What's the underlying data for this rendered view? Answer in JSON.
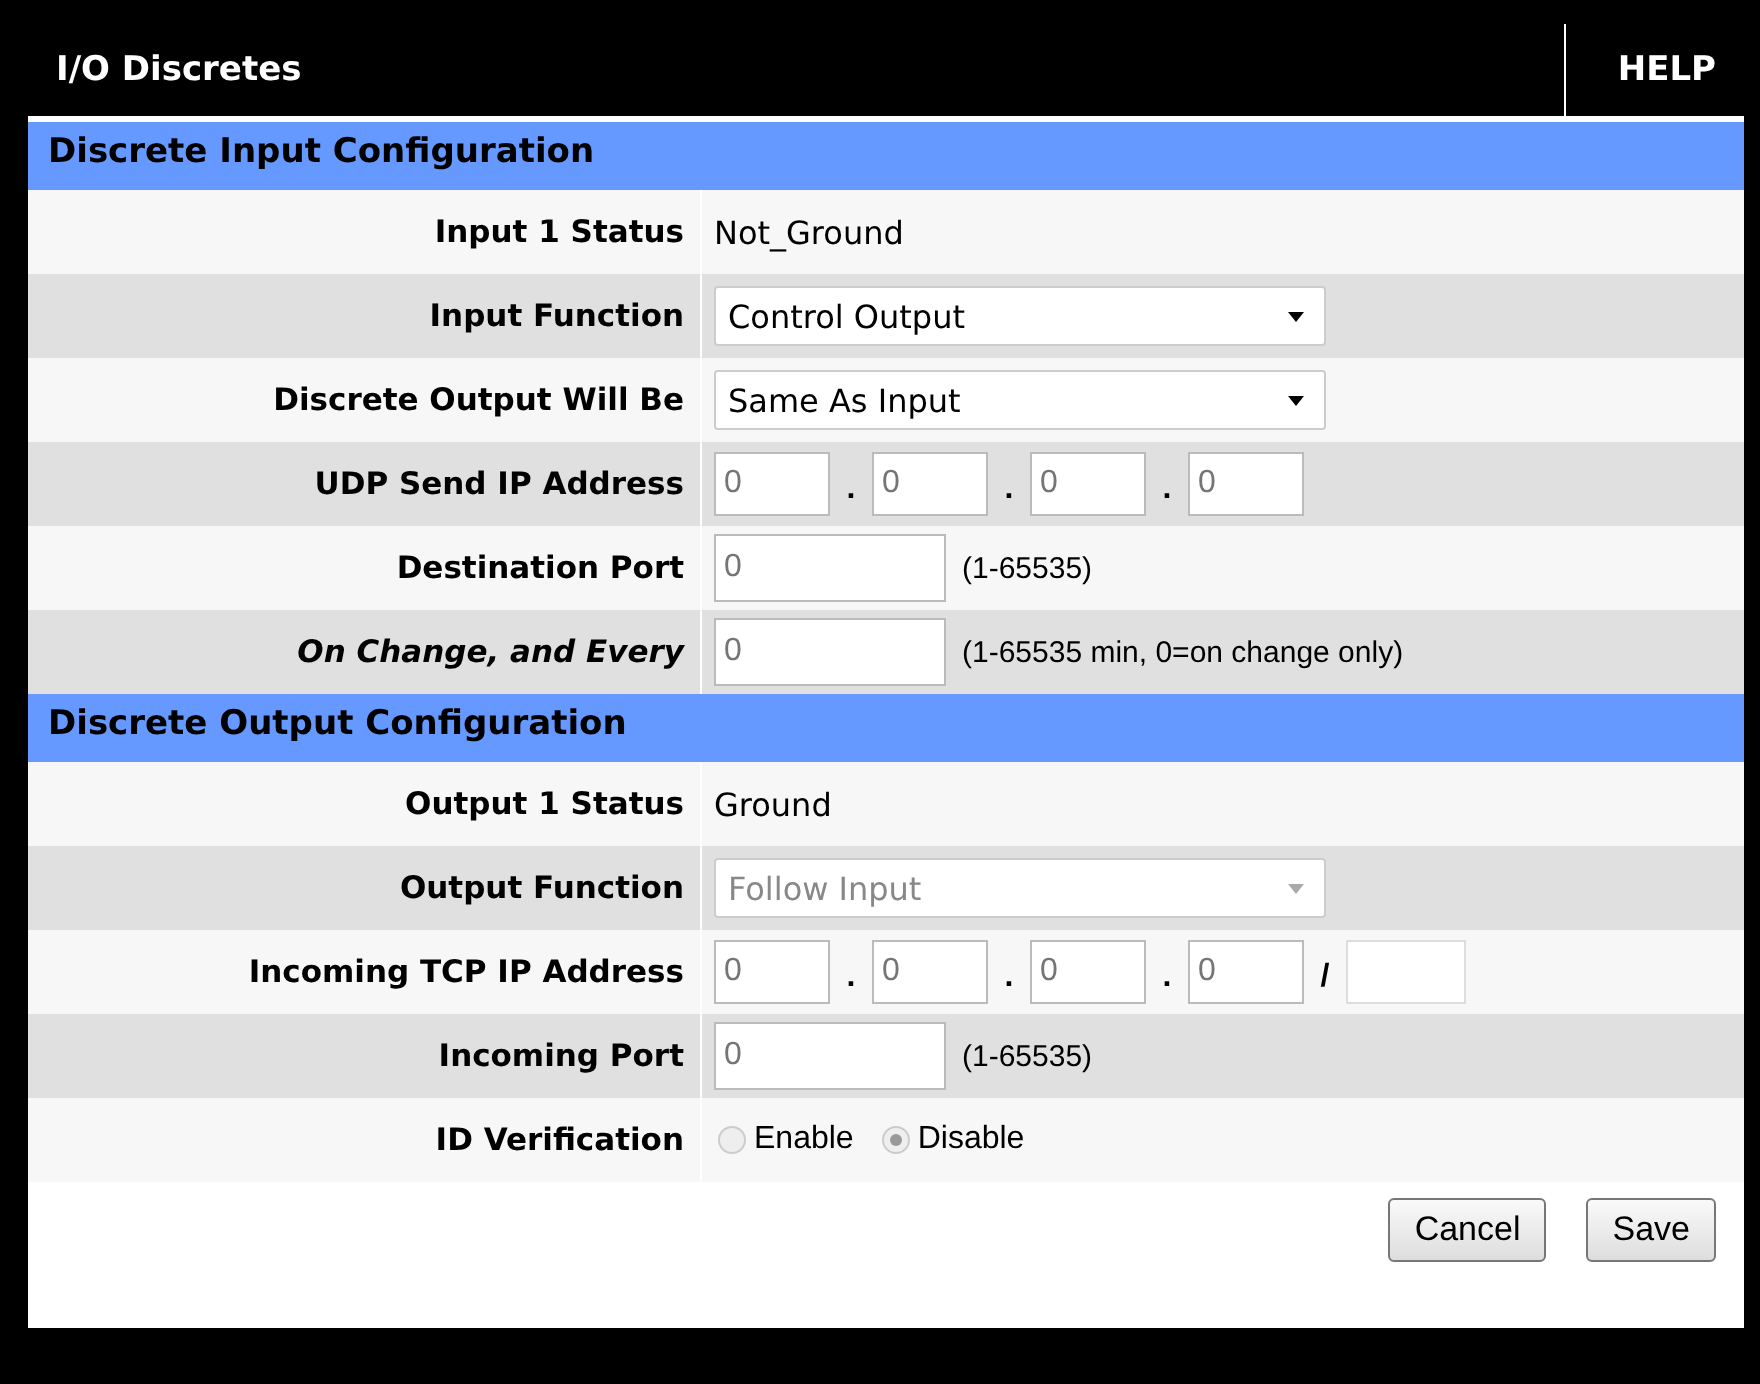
{
  "header": {
    "title": "I/O Discretes",
    "help": "HELP"
  },
  "sections": [
    {
      "title": "Discrete Input Configuration",
      "rows": [
        {
          "kind": "text",
          "label": "Input 1 Status",
          "italic": false,
          "value": "Not_Ground"
        },
        {
          "kind": "select",
          "label": "Input Function",
          "italic": false,
          "value": "Control Output",
          "disabled": false
        },
        {
          "kind": "select",
          "label": "Discrete Output Will Be",
          "italic": false,
          "value": "Same As Input",
          "disabled": false
        },
        {
          "kind": "ip",
          "label": "UDP Send IP Address",
          "italic": false,
          "placeholders": [
            "0",
            "0",
            "0",
            "0"
          ],
          "separators": [
            ".",
            ".",
            "."
          ]
        },
        {
          "kind": "input",
          "label": "Destination Port",
          "italic": false,
          "placeholder": "0",
          "hint": "(1-65535)"
        },
        {
          "kind": "input",
          "label": "On Change, and Every",
          "italic": true,
          "placeholder": "0",
          "hint": "(1-65535 min, 0=on change only)"
        }
      ]
    },
    {
      "title": "Discrete Output Configuration",
      "rows": [
        {
          "kind": "text",
          "label": "Output 1 Status",
          "italic": false,
          "value": "Ground"
        },
        {
          "kind": "select",
          "label": "Output Function",
          "italic": false,
          "value": "Follow Input",
          "disabled": true
        },
        {
          "kind": "ip",
          "label": "Incoming TCP IP Address",
          "italic": false,
          "placeholders": [
            "0",
            "0",
            "0",
            "0"
          ],
          "separators": [
            ".",
            ".",
            ".",
            "/"
          ],
          "mask": true
        },
        {
          "kind": "input",
          "label": "Incoming Port",
          "italic": false,
          "placeholder": "0",
          "hint": "(1-65535)"
        },
        {
          "kind": "radio",
          "label": "ID Verification",
          "italic": false,
          "options": [
            {
              "label": "Enable",
              "selected": false
            },
            {
              "label": "Disable",
              "selected": true
            }
          ]
        }
      ]
    }
  ],
  "buttons": [
    "Cancel",
    "Save"
  ]
}
